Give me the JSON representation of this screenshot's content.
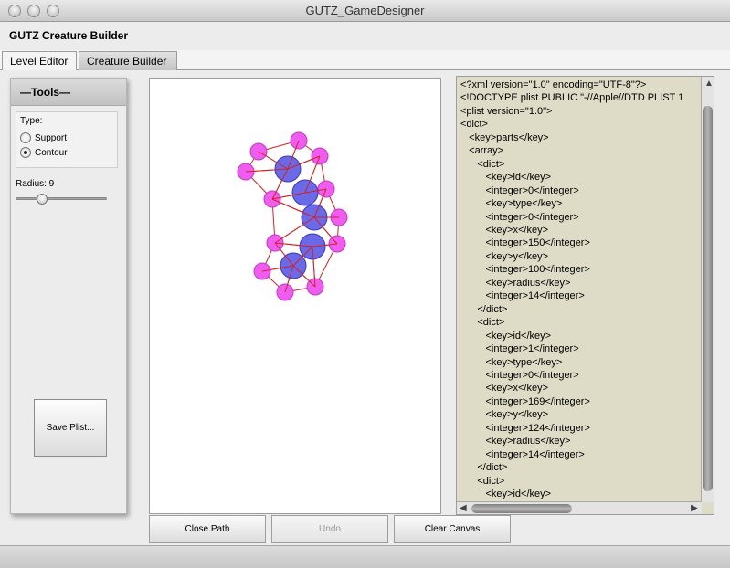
{
  "window": {
    "title": "GUTZ_GameDesigner"
  },
  "app": {
    "header": "GUTZ Creature Builder"
  },
  "tabs": [
    {
      "label": "Level Editor",
      "active": false
    },
    {
      "label": "Creature Builder",
      "active": true
    }
  ],
  "tools": {
    "header": "—Tools—",
    "type_label": "Type:",
    "options": [
      {
        "label": "Support",
        "selected": false
      },
      {
        "label": "Contour",
        "selected": true
      }
    ],
    "radius_label": "Radius: 9",
    "radius_slider_fraction": 0.28,
    "save_label": "Save Plist..."
  },
  "canvas": {
    "colors": {
      "support": "#6a6ae8",
      "support_stroke": "#3a3ab8",
      "contour": "#f05cf0",
      "contour_stroke": "#c23ac2",
      "edge": "#d62020"
    }
  },
  "xml": {
    "lines": [
      "<?xml version=\"1.0\" encoding=\"UTF-8\"?>",
      "<!DOCTYPE plist PUBLIC \"-//Apple//DTD PLIST 1",
      "<plist version=\"1.0\">",
      "<dict>",
      "   <key>parts</key>",
      "   <array>",
      "      <dict>",
      "         <key>id</key>",
      "         <integer>0</integer>",
      "         <key>type</key>",
      "         <integer>0</integer>",
      "         <key>x</key>",
      "         <integer>150</integer>",
      "         <key>y</key>",
      "         <integer>100</integer>",
      "         <key>radius</key>",
      "         <integer>14</integer>",
      "      </dict>",
      "      <dict>",
      "         <key>id</key>",
      "         <integer>1</integer>",
      "         <key>type</key>",
      "         <integer>0</integer>",
      "         <key>x</key>",
      "         <integer>169</integer>",
      "         <key>y</key>",
      "         <integer>124</integer>",
      "         <key>radius</key>",
      "         <integer>14</integer>",
      "      </dict>",
      "      <dict>",
      "         <key>id</key>"
    ]
  },
  "buttons": {
    "close_path": "Close Path",
    "undo": "Undo",
    "clear_canvas": "Clear Canvas"
  }
}
